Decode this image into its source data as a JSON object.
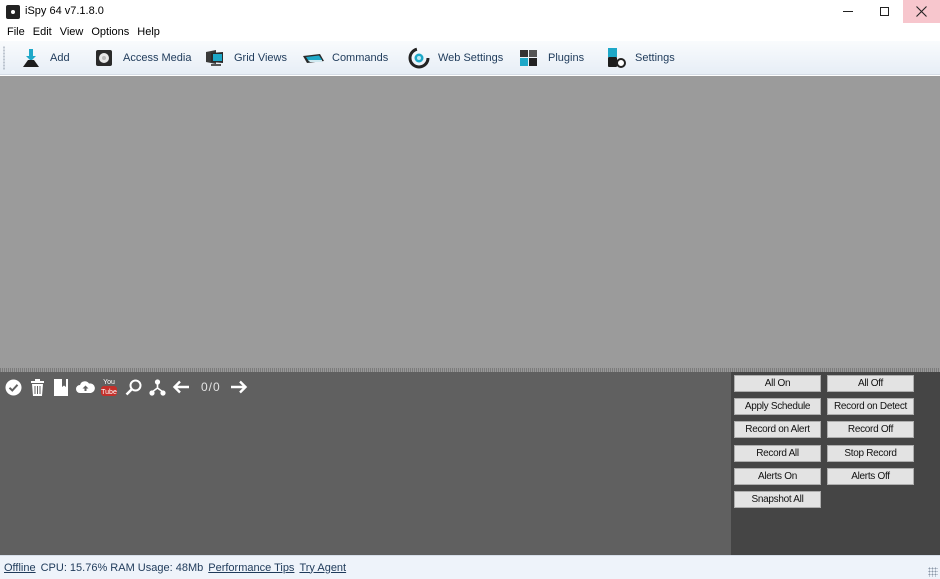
{
  "window": {
    "title": "iSpy 64 v7.1.8.0",
    "controls": {
      "minimize": "minimize",
      "maximize": "maximize",
      "close": "close"
    }
  },
  "menu": [
    "File",
    "Edit",
    "View",
    "Options",
    "Help"
  ],
  "toolbar": [
    {
      "label": "Add",
      "icon": "add-icon"
    },
    {
      "label": "Access Media",
      "icon": "media-icon"
    },
    {
      "label": "Grid Views",
      "icon": "grid-views-icon"
    },
    {
      "label": "Commands",
      "icon": "commands-icon"
    },
    {
      "label": "Web Settings",
      "icon": "web-settings-icon"
    },
    {
      "label": "Plugins",
      "icon": "plugins-icon"
    },
    {
      "label": "Settings",
      "icon": "settings-icon"
    }
  ],
  "bottom_tools": {
    "icons": [
      "check-circle-icon",
      "trash-icon",
      "bookmark-icon",
      "cloud-upload-icon",
      "youtube-icon",
      "search-icon",
      "sitemap-icon",
      "arrow-left-icon"
    ],
    "youtube_text_top": "You",
    "youtube_text_bottom": "Tube",
    "page_count": "0/0",
    "next_icon": "arrow-right-icon"
  },
  "commands": [
    "All On",
    "All Off",
    "Apply Schedule",
    "Record on Detect",
    "Record on Alert",
    "Record Off",
    "Record All",
    "Stop Record",
    "Alerts On",
    "Alerts Off",
    "Snapshot All"
  ],
  "status": {
    "connection": "Offline",
    "stats": "CPU: 15.76% RAM Usage: 48Mb",
    "performance_tips": "Performance Tips",
    "try_agent": "Try Agent"
  },
  "colors": {
    "accent": "#1ea8c8",
    "main_bg": "#9b9b9b",
    "panel_bg": "#606060",
    "command_panel_bg": "#454545",
    "close_hover": "#f7c6cd"
  }
}
